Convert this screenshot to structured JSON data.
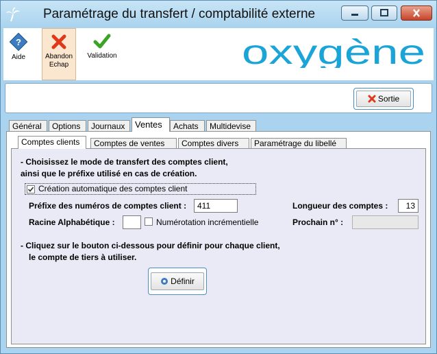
{
  "window": {
    "title": "Paramétrage du transfert / comptabilité externe"
  },
  "toolbar": {
    "aide": "Aide",
    "abandon_line1": "Abandon",
    "abandon_line2": "Echap",
    "validation": "Validation",
    "logo_text": "oxygène"
  },
  "sortie": {
    "label": "Sortie"
  },
  "tabs": [
    "Général",
    "Options",
    "Journaux",
    "Ventes",
    "Achats",
    "Multidevise"
  ],
  "subtabs": [
    "Comptes clients",
    "Comptes de ventes",
    "Comptes divers",
    "Paramétrage du libellé"
  ],
  "content": {
    "intro_line1": "- Choisissez le mode de transfert des comptes client,",
    "intro_line2": "ainsi que le préfixe utilisé en cas de création.",
    "auto_create_label": "Création automatique des comptes client",
    "auto_create_checked": true,
    "prefix_label": "Préfixe des numéros de comptes client :",
    "prefix_value": "411",
    "length_label": "Longueur des comptes :",
    "length_value": "13",
    "racine_label": "Racine Alphabétique :",
    "racine_value": "",
    "numerotation_label": "Numérotation incrémentielle",
    "numerotation_checked": false,
    "prochain_label": "Prochain n° :",
    "prochain_value": "",
    "help_line1": "- Cliquez sur le bouton ci-dessous pour définir pour chaque client,",
    "help_line2": "le compte de tiers à utiliser.",
    "definir_label": "Définir"
  }
}
